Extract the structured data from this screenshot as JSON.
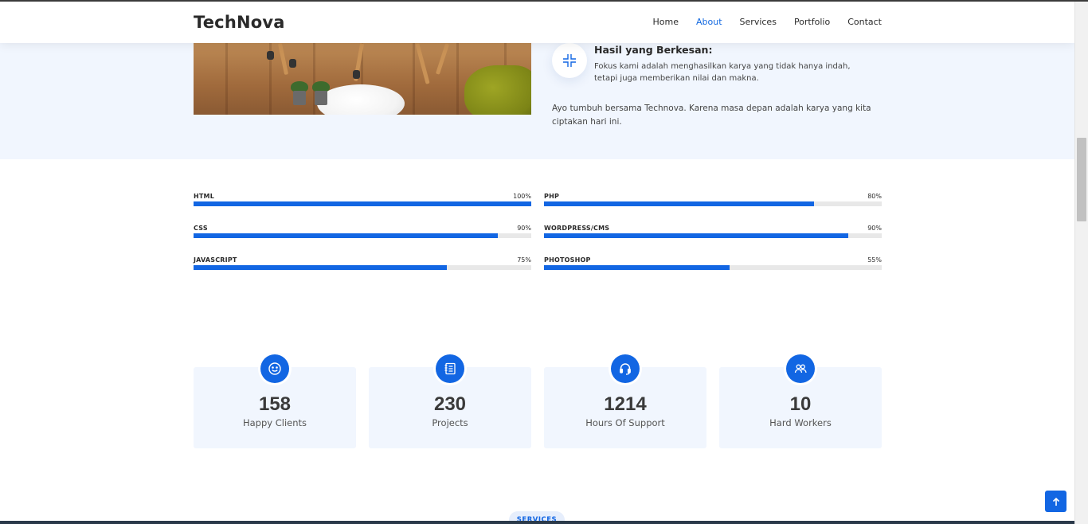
{
  "header": {
    "logo": "TechNova",
    "nav": [
      "Home",
      "About",
      "Services",
      "Portfolio",
      "Contact"
    ],
    "active": "About"
  },
  "about": {
    "feature_title": "Hasil yang Berkesan:",
    "feature_desc": "Fokus kami adalah menghasilkan karya yang tidak hanya indah, tetapi juga memberikan nilai dan makna.",
    "paragraph": "Ayo tumbuh bersama Technova. Karena masa depan adalah karya yang kita ciptakan hari ini.",
    "feature_icon": "compress-arrows-icon"
  },
  "skills": {
    "left": [
      {
        "label": "HTML",
        "value_text": "100%",
        "percent": 100
      },
      {
        "label": "CSS",
        "value_text": "90%",
        "percent": 90
      },
      {
        "label": "JAVASCRIPT",
        "value_text": "75%",
        "percent": 75
      }
    ],
    "right": [
      {
        "label": "PHP",
        "value_text": "80%",
        "percent": 80
      },
      {
        "label": "WORDPRESS/CMS",
        "value_text": "90%",
        "percent": 90
      },
      {
        "label": "PHOTOSHOP",
        "value_text": "55%",
        "percent": 55
      }
    ]
  },
  "stats": [
    {
      "number": "158",
      "label": "Happy Clients",
      "icon": "smile-icon"
    },
    {
      "number": "230",
      "label": "Projects",
      "icon": "journal-icon"
    },
    {
      "number": "1214",
      "label": "Hours Of Support",
      "icon": "headset-icon"
    },
    {
      "number": "10",
      "label": "Hard Workers",
      "icon": "people-icon"
    }
  ],
  "services_badge": "SERVICES",
  "colors": {
    "accent": "#1266e3",
    "section_bg": "#f1f6fe",
    "text": "#2a2a2a"
  }
}
